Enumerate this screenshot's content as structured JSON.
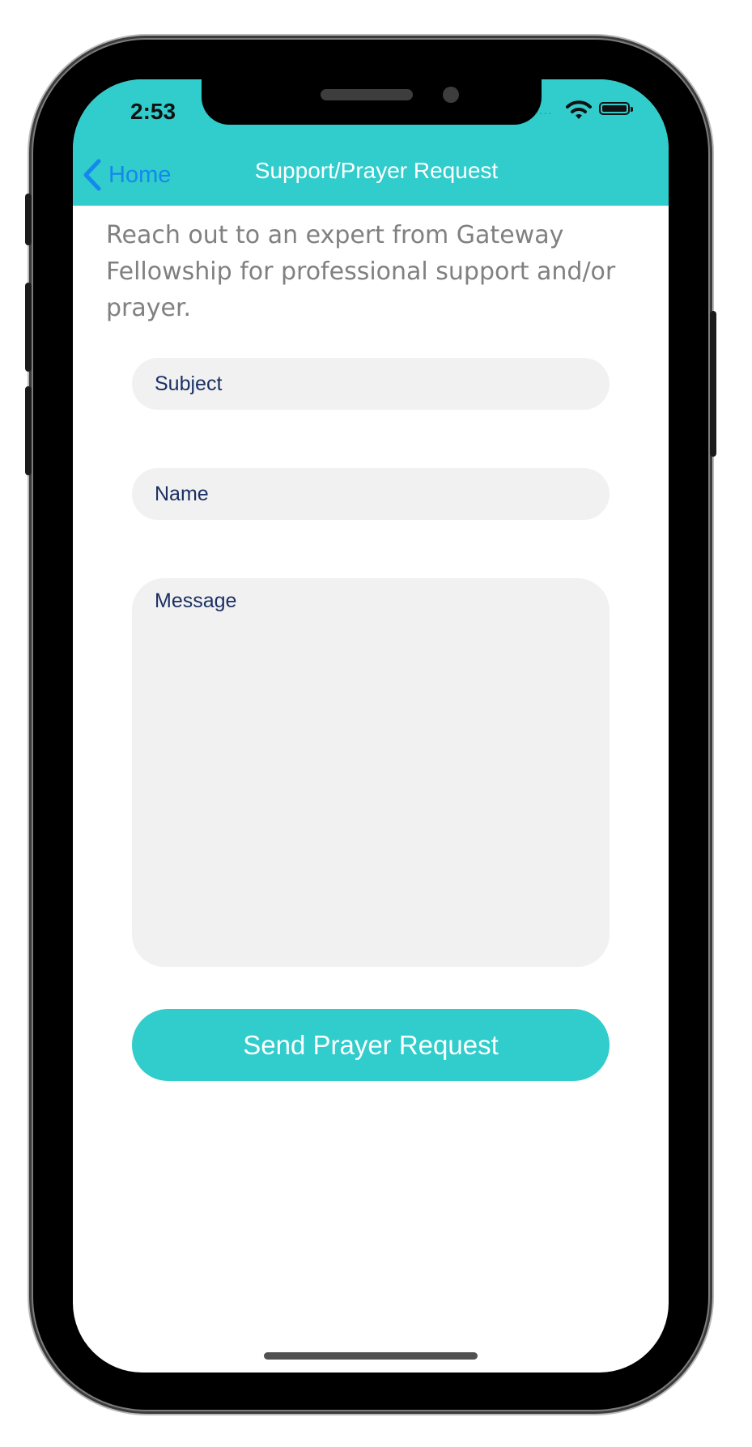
{
  "status": {
    "time": "2:53",
    "signal_icon": "signal-dots-icon",
    "wifi_icon": "wifi-icon",
    "battery_icon": "battery-icon"
  },
  "nav": {
    "back_label": "Home",
    "title": "Support/Prayer Request"
  },
  "intro": "Reach out to an expert from Gateway Fellowship for professional support and/or prayer.",
  "form": {
    "subject_placeholder": "Subject",
    "name_placeholder": "Name",
    "message_placeholder": "Message",
    "submit_label": "Send Prayer Request"
  },
  "colors": {
    "accent": "#31cccc",
    "back_link": "#1488ee",
    "field_bg": "#f1f1f1",
    "field_text": "#1b2f63",
    "intro_text": "#808080"
  }
}
